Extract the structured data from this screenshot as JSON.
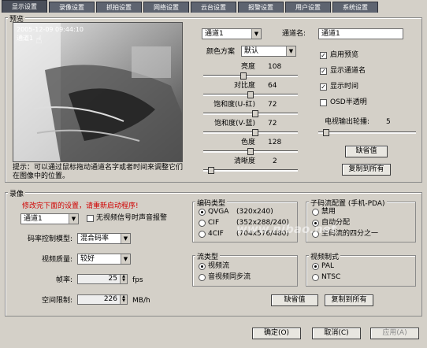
{
  "tabs": [
    "显示设置",
    "录像设置",
    "抓拍设置",
    "网络设置",
    "云台设置",
    "报警设置",
    "用户设置",
    "系统设置"
  ],
  "preview": {
    "group_label": "预览",
    "overlay_title": "2005-12-09 09:44:10",
    "overlay_channel": "通道1",
    "hint": "提示：可以通过鼠标拖动通道名字或者时间来调整它们在图像中的位置。"
  },
  "display": {
    "channel_select": "通道1",
    "channel_name_label": "通道名:",
    "channel_name_value": "通道1",
    "color_scheme_label": "颜色方案",
    "color_scheme_value": "默认",
    "sliders": [
      {
        "label": "亮度",
        "value": "108",
        "level": 0.42
      },
      {
        "label": "对比度",
        "value": "64",
        "level": 0.5
      },
      {
        "label": "饱和度(U-红)",
        "value": "72",
        "level": 0.55
      },
      {
        "label": "饱和度(V-蓝)",
        "value": "72",
        "level": 0.55
      },
      {
        "label": "色度",
        "value": "128",
        "level": 0.5
      },
      {
        "label": "清晰度",
        "value": "2",
        "level": 0.05
      }
    ],
    "checkboxes": [
      {
        "label": "启用预览",
        "checked": true
      },
      {
        "label": "显示通道名",
        "checked": true
      },
      {
        "label": "显示时间",
        "checked": true
      },
      {
        "label": "OSD半透明",
        "checked": false
      }
    ],
    "tv_output_label": "电视输出轮播:",
    "tv_output_value": "5",
    "tv_output_level": 0.05,
    "default_button": "缺省值",
    "copy_all_button": "复制到所有"
  },
  "record": {
    "group_label": "录像",
    "warning": "修改完下面的设置，请重新启动程序!",
    "channel_select": "通道1",
    "no_video_alarm_label": "无视频信号时声音报警",
    "rate_mode_label": "码率控制模型:",
    "rate_mode_value": "混合码率",
    "video_quality_label": "视频质量:",
    "video_quality_value": "较好",
    "frame_rate_label": "帧率:",
    "frame_rate_value": "25",
    "frame_rate_unit": "fps",
    "space_limit_label": "空间限制:",
    "space_limit_value": "226",
    "space_limit_unit": "MB/h",
    "encoding": {
      "group_label": "编码类型",
      "options": [
        {
          "name": "QVGA",
          "res": "(320x240)",
          "on": true
        },
        {
          "name": "CIF",
          "res": "(352x288/240)",
          "on": false
        },
        {
          "name": "4CIF",
          "res": "(704x576/480)",
          "on": false
        }
      ]
    },
    "stream": {
      "group_label": "流类型",
      "options": [
        {
          "name": "视频流",
          "on": true
        },
        {
          "name": "音视频同步流",
          "on": false
        }
      ]
    },
    "sub_stream": {
      "group_label": "子码流配置 (手机-PDA)",
      "options": [
        {
          "name": "禁用",
          "on": false
        },
        {
          "name": "自动分配",
          "on": true
        },
        {
          "name": "主码流的四分之一",
          "on": false
        }
      ]
    },
    "video_format": {
      "group_label": "视频制式",
      "options": [
        {
          "name": "PAL",
          "on": true
        },
        {
          "name": "NTSC",
          "on": false
        }
      ]
    },
    "default_button": "缺省值",
    "copy_all_button": "复制到所有"
  },
  "footer": {
    "ok_button": "确定(O)",
    "cancel_button": "取消(C)",
    "apply_button": "应用(A)"
  },
  "watermark": "www.nibao.net",
  "colors": {
    "tab_bg": "#5e6470",
    "panel_bg": "#d4d0c8",
    "warning": "#d00000"
  }
}
